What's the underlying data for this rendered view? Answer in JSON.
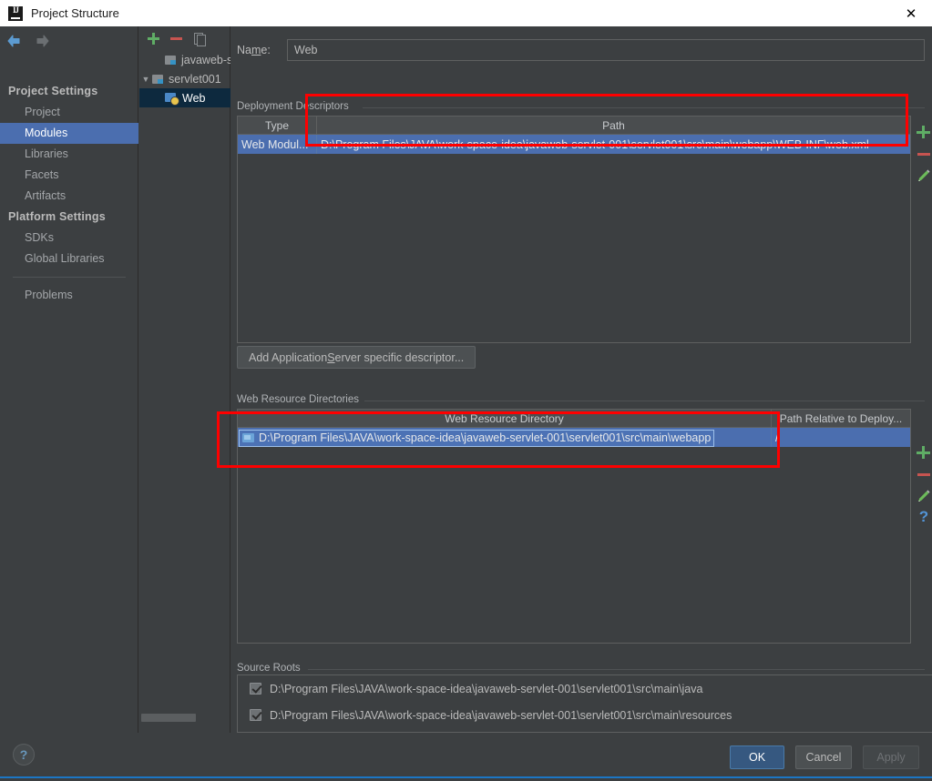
{
  "window": {
    "title": "Project Structure",
    "app_icon": "intellij-idea-icon",
    "close_label": "✕"
  },
  "toolbar": {
    "back_icon": "back-arrow-icon",
    "forward_icon": "forward-arrow-icon"
  },
  "sidebar": {
    "groups": [
      {
        "label": "Project Settings",
        "items": [
          {
            "label": "Project",
            "selected": false
          },
          {
            "label": "Modules",
            "selected": true
          },
          {
            "label": "Libraries",
            "selected": false
          },
          {
            "label": "Facets",
            "selected": false
          },
          {
            "label": "Artifacts",
            "selected": false
          }
        ]
      },
      {
        "label": "Platform Settings",
        "items": [
          {
            "label": "SDKs",
            "selected": false
          },
          {
            "label": "Global Libraries",
            "selected": false
          }
        ]
      }
    ],
    "problems_label": "Problems"
  },
  "tree_panel": {
    "toolbar": {
      "add_icon": "plus-icon",
      "remove_icon": "minus-icon",
      "copy_icon": "copy-icon"
    },
    "nodes": [
      {
        "label": "javaweb-s",
        "icon": "module-icon",
        "expander": "",
        "indent": 1,
        "selected": false
      },
      {
        "label": "servlet001",
        "icon": "module-icon",
        "expander": "▼",
        "indent": 0,
        "selected": false
      },
      {
        "label": "Web",
        "icon": "web-facet-icon",
        "expander": "",
        "indent": 2,
        "selected": true
      }
    ]
  },
  "main": {
    "name_field": {
      "label_pre": "Na",
      "label_accel": "m",
      "label_post": "e:",
      "value": "Web",
      "placeholder": ""
    },
    "deployment_descriptors": {
      "caption": "Deployment Descriptors",
      "columns": [
        "Type",
        "Path"
      ],
      "rows": [
        {
          "type": "Web Modul...",
          "path": "D:\\Program Files\\JAVA\\work-space-idea\\javaweb-servlet-001\\servlet001\\src\\main\\webapp\\WEB-INF\\web.xml",
          "selected": true
        }
      ],
      "actions": [
        {
          "icon": "plus-icon",
          "name": "add-descriptor"
        },
        {
          "icon": "minus-icon",
          "name": "remove-descriptor"
        },
        {
          "icon": "pencil-icon",
          "name": "edit-descriptor"
        }
      ]
    },
    "add_descriptor_button": {
      "pre": "Add Application ",
      "accel": "S",
      "post": "erver specific descriptor..."
    },
    "web_resource_directories": {
      "caption": "Web Resource Directories",
      "columns": [
        "Web Resource Directory",
        "Path Relative to Deploy..."
      ],
      "rows": [
        {
          "directory": "D:\\Program Files\\JAVA\\work-space-idea\\javaweb-servlet-001\\servlet001\\src\\main\\webapp",
          "relative_path": "/",
          "folder_icon": "folder-icon",
          "selected": true,
          "editing": true
        }
      ],
      "actions": [
        {
          "icon": "plus-icon",
          "name": "add-web-resource"
        },
        {
          "icon": "minus-icon",
          "name": "remove-web-resource"
        },
        {
          "icon": "pencil-icon",
          "name": "edit-web-resource"
        },
        {
          "icon": "help-icon",
          "name": "web-resource-help"
        }
      ]
    },
    "source_roots": {
      "caption": "Source Roots",
      "items": [
        {
          "path": "D:\\Program Files\\JAVA\\work-space-idea\\javaweb-servlet-001\\servlet001\\src\\main\\java",
          "checked": true
        },
        {
          "path": "D:\\Program Files\\JAVA\\work-space-idea\\javaweb-servlet-001\\servlet001\\src\\main\\resources",
          "checked": true
        }
      ]
    }
  },
  "footer": {
    "help_label": "?",
    "ok_label": "OK",
    "cancel_label": "Cancel",
    "apply_label": "Apply"
  },
  "annotations": {
    "highlight_color": "#fe0000",
    "boxes": [
      "deployment-descriptor-path-row",
      "web-resource-directory-row"
    ]
  },
  "colors": {
    "window_bg": "#3c3f41",
    "selection_blue": "#4b6eaf",
    "tree_selection": "#0d293e",
    "accent_ok": "#365880",
    "add_green": "#5fad65",
    "remove_red": "#c75450"
  }
}
